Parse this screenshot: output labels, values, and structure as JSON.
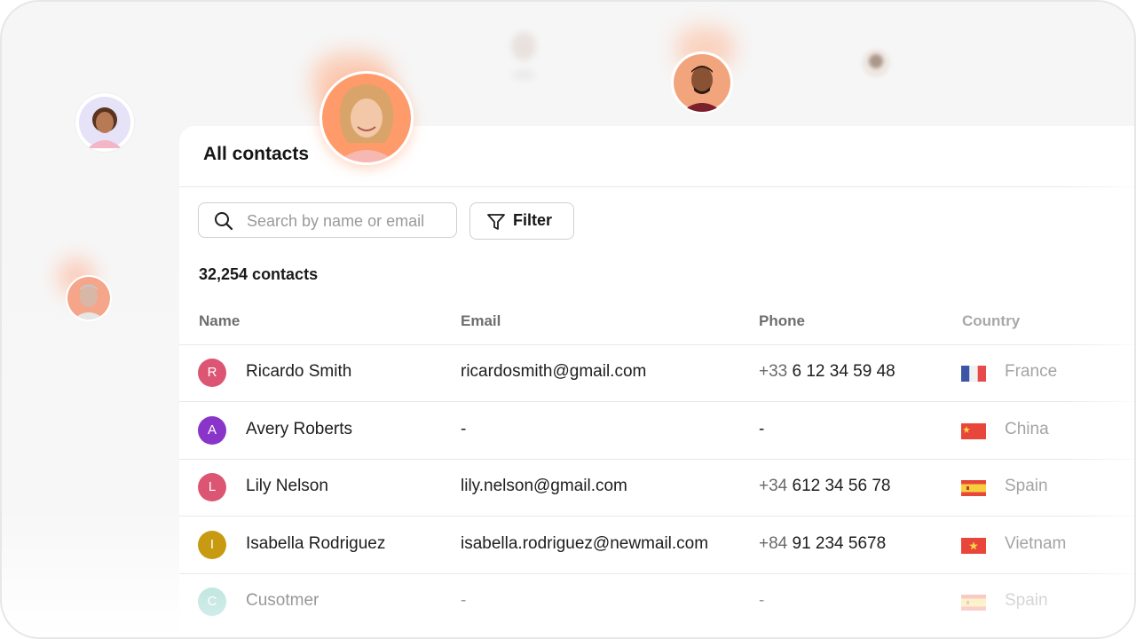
{
  "panel": {
    "title": "All contacts"
  },
  "search": {
    "placeholder": "Search by name or email"
  },
  "filter": {
    "label": "Filter"
  },
  "summary": {
    "count": "32,254 contacts"
  },
  "table": {
    "columns": [
      "Name",
      "Email",
      "Phone",
      "Country"
    ],
    "rows": [
      {
        "initial": "R",
        "color": "#dc5673",
        "name": "Ricardo Smith",
        "email": "ricardosmith@gmail.com",
        "phone_code": "+33",
        "phone_number": "6 12 34 59 48",
        "country": "France",
        "flag": "france"
      },
      {
        "initial": "A",
        "color": "#8a35c9",
        "name": "Avery Roberts",
        "email": "-",
        "phone_code": "",
        "phone_number": "-",
        "country": "China",
        "flag": "china"
      },
      {
        "initial": "L",
        "color": "#dc5673",
        "name": "Lily Nelson",
        "email": "lily.nelson@gmail.com",
        "phone_code": "+34",
        "phone_number": "612 34 56 78",
        "country": "Spain",
        "flag": "spain"
      },
      {
        "initial": "I",
        "color": "#c89a12",
        "name": "Isabella Rodriguez",
        "email": "isabella.rodriguez@newmail.com",
        "phone_code": "+84",
        "phone_number": "91 234 5678",
        "country": "Vietnam",
        "flag": "vietnam"
      },
      {
        "initial": "C",
        "color": "#88cfc6",
        "name": "Cusotmer",
        "email": "-",
        "phone_code": "",
        "phone_number": "-",
        "country": "Spain",
        "flag": "spain"
      }
    ]
  },
  "colors": {
    "glow": "#ff9f6e",
    "border": "#e7e7e7"
  },
  "icons": [
    "search-icon",
    "filter-icon",
    "flag-france-icon",
    "flag-china-icon",
    "flag-spain-icon",
    "flag-vietnam-icon"
  ]
}
